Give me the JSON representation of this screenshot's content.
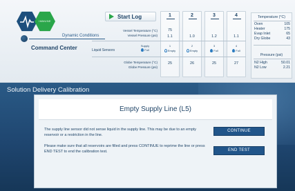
{
  "header": {
    "dynamic_conditions_label": "Dynamic Conditions",
    "command_center_label": "Command Center",
    "logo_text": "IMMUNE",
    "start_log_label": "Start Log"
  },
  "vessels": {
    "numbers": [
      "1",
      "2",
      "3",
      "4"
    ],
    "row_labels": {
      "vessel_temperature": "Vessel Temperature (°C)",
      "vessel_pressure": "Vessel Pressure (psi)",
      "liquid_sensors": "Liquid Sensors",
      "supply": "Supply",
      "globe_temperature": "Globe Temperature (°C)",
      "globe_pressure": "Globe Pressure (psi)"
    },
    "vessel_temperature": [
      "75",
      "",
      "",
      ""
    ],
    "vessel_pressure": [
      "1.1",
      "1.0",
      "1.2",
      "1.1"
    ],
    "supply_status": "Full",
    "sensors": [
      {
        "num": "1",
        "status": "Empty"
      },
      {
        "num": "2",
        "status": "Empty"
      },
      {
        "num": "3",
        "status": "Full"
      },
      {
        "num": "4",
        "status": "Full"
      }
    ],
    "globe_temperature": [
      "25",
      "26",
      "25",
      "27"
    ],
    "globe_pressure": [
      "",
      "",
      "",
      ""
    ]
  },
  "right_panel": {
    "temperature_title": "Temperature (°C)",
    "temperature_rows": [
      {
        "label": "Oven",
        "value": "105"
      },
      {
        "label": "Heater",
        "value": "175"
      },
      {
        "label": "Evap Inlet",
        "value": "65"
      },
      {
        "label": "Dry Globe",
        "value": "43"
      }
    ],
    "pressure_title": "Pressure (psi)",
    "pressure_rows": [
      {
        "label": "N2 High",
        "value": "50.01"
      },
      {
        "label": "N2 Low",
        "value": "2.21"
      }
    ]
  },
  "section": {
    "title": "Solution Delivery Calibration"
  },
  "dialog": {
    "title": "Empty Supply Line (L5)",
    "message_1": "The supply line sensor did not sense liquid in the supply line. This may be due to an empty reservoir or a restriction in the line.",
    "message_2": "Please make sure that all reservoirs are filled and press CONTINUE to reprime the line or press END TEST to end the calibration test.",
    "continue_label": "CONTINUE",
    "end_test_label": "END TEST"
  },
  "colors": {
    "brand_blue": "#1d4f7d",
    "brand_green": "#2aa64a",
    "button_blue": "#21558a",
    "text_navy": "#1f4467"
  }
}
